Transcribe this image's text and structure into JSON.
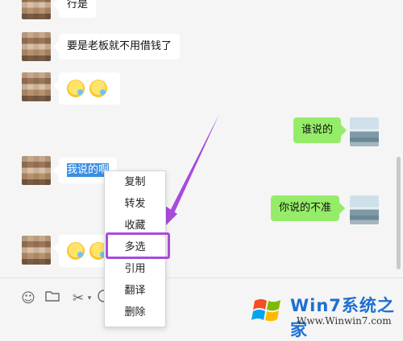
{
  "messages": [
    {
      "side": "left",
      "text": "行是",
      "partial": true
    },
    {
      "side": "left",
      "text": "要是老板就不用借钱了"
    },
    {
      "side": "left",
      "emoji": [
        "sweat-smile-emoji",
        "sweat-smile-emoji"
      ]
    },
    {
      "side": "right",
      "text": "谁说的"
    },
    {
      "side": "left",
      "text": "我说的啊",
      "selected": true
    },
    {
      "side": "right",
      "text": "你说的不准"
    },
    {
      "side": "left",
      "emoji": [
        "sweat-smile-emoji",
        "sweat-smile-emoji"
      ]
    }
  ],
  "context_menu": {
    "items": [
      "复制",
      "转发",
      "收藏",
      "多选",
      "引用",
      "翻译",
      "删除"
    ],
    "highlighted": "多选",
    "highlight_color": "#a84bdc"
  },
  "toolbar": {
    "icons": [
      "emoji-icon",
      "folder-icon",
      "scissors-icon",
      "chat-history-icon"
    ]
  },
  "watermark": {
    "brand": "Win7系统之家",
    "url": "Www.Winwin7.com"
  },
  "colors": {
    "sent_bubble": "#95ec69",
    "received_bubble": "#ffffff",
    "selection": "#3b8fe0",
    "annotation": "#a84bdc"
  }
}
